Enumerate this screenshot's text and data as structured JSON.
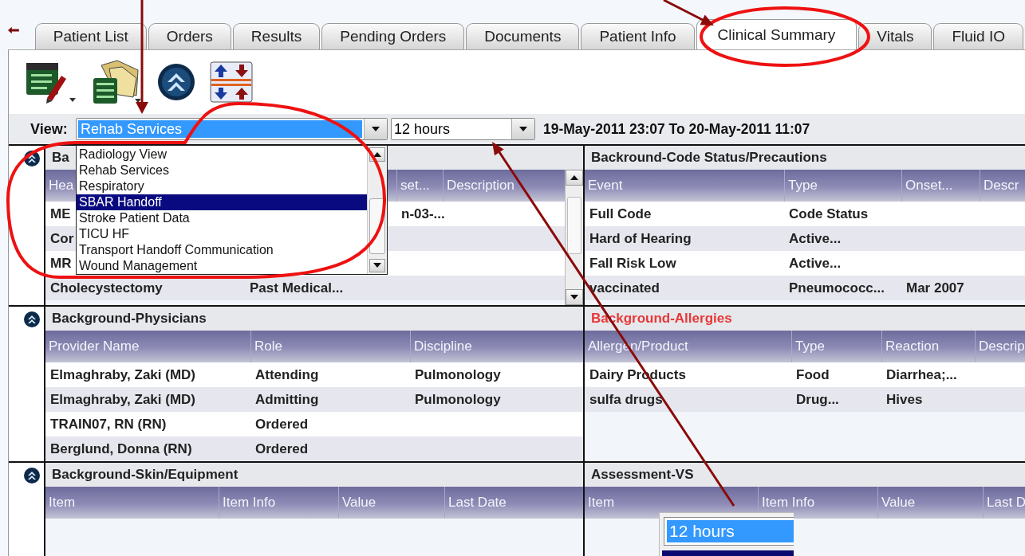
{
  "tabs": [
    {
      "label": "Patient List",
      "selected": false
    },
    {
      "label": "Orders",
      "selected": false
    },
    {
      "label": "Results",
      "selected": false
    },
    {
      "label": "Pending Orders",
      "selected": false
    },
    {
      "label": "Documents",
      "selected": false
    },
    {
      "label": "Patient Info",
      "selected": false
    },
    {
      "label": "Clinical Summary",
      "selected": true
    },
    {
      "label": "Vitals",
      "selected": false
    },
    {
      "label": "Fluid IO",
      "selected": false
    }
  ],
  "view": {
    "label": "View:",
    "value": "Rehab Services",
    "range": "12 hours",
    "period": "19-May-2011 23:07 To 20-May-2011 11:07"
  },
  "view_list": {
    "items": [
      {
        "label": "Radiology View",
        "selected": false
      },
      {
        "label": "Rehab Services",
        "selected": false
      },
      {
        "label": "Respiratory",
        "selected": false
      },
      {
        "label": "SBAR Handoff",
        "selected": true
      },
      {
        "label": "Stroke Patient Data",
        "selected": false
      },
      {
        "label": "TICU HF",
        "selected": false
      },
      {
        "label": "Transport Handoff Communication",
        "selected": false
      },
      {
        "label": "Wound Management",
        "selected": false
      }
    ]
  },
  "sections": [
    {
      "title": "Ba",
      "alert": false,
      "collapsible": true,
      "scrollable": true,
      "columns": [
        "Hea",
        null,
        "set...",
        "Description"
      ],
      "rows": [
        [
          "ME",
          null,
          "n-03-...",
          null
        ],
        [
          "Cor",
          null,
          null,
          null
        ],
        [
          "MR",
          null,
          null,
          null
        ],
        [
          "Cholecystectomy",
          "Past Medical...",
          null,
          null
        ]
      ]
    },
    {
      "title": "Backround-Code Status/Precautions",
      "alert": false,
      "collapsible": false,
      "scrollable": false,
      "columns": [
        "Event",
        "Type",
        "Onset...",
        "Descr"
      ],
      "rows": [
        [
          "Full Code",
          "Code  Status",
          null,
          null
        ],
        [
          "Hard of Hearing",
          "Active...",
          null,
          null
        ],
        [
          "Fall Risk Low",
          "Active...",
          null,
          null
        ],
        [
          "vaccinated",
          "Pneumococc...",
          "Mar 2007",
          null
        ]
      ]
    },
    {
      "title": "Background-Physicians",
      "alert": false,
      "collapsible": true,
      "scrollable": false,
      "columns": [
        "Provider Name",
        "Role",
        "Discipline"
      ],
      "rows": [
        [
          "Elmaghraby, Zaki (MD)",
          "Attending",
          "Pulmonology"
        ],
        [
          "Elmaghraby, Zaki (MD)",
          "Admitting",
          "Pulmonology"
        ],
        [
          "TRAIN07, RN (RN)",
          "Ordered",
          null
        ],
        [
          "Berglund, Donna (RN)",
          "Ordered",
          null
        ]
      ]
    },
    {
      "title": "Background-Allergies",
      "alert": true,
      "collapsible": false,
      "scrollable": false,
      "columns": [
        "Allergen/Product",
        "Type",
        "Reaction",
        "Descrip"
      ],
      "rows": [
        [
          "Dairy Products",
          "Food",
          "Diarrhea;...",
          null
        ],
        [
          "sulfa drugs",
          "Drug...",
          "Hives",
          null
        ]
      ]
    },
    {
      "title": "Background-Skin/Equipment",
      "alert": false,
      "collapsible": true,
      "scrollable": false,
      "columns": [
        "Item",
        "Item Info",
        "Value",
        "Last Date"
      ]
    },
    {
      "title": "Assessment-VS",
      "alert": false,
      "collapsible": false,
      "scrollable": false,
      "columns": [
        "Item",
        "Item Info",
        "Value",
        "Last D"
      ]
    }
  ],
  "time_popup": {
    "value": "12 hours"
  }
}
